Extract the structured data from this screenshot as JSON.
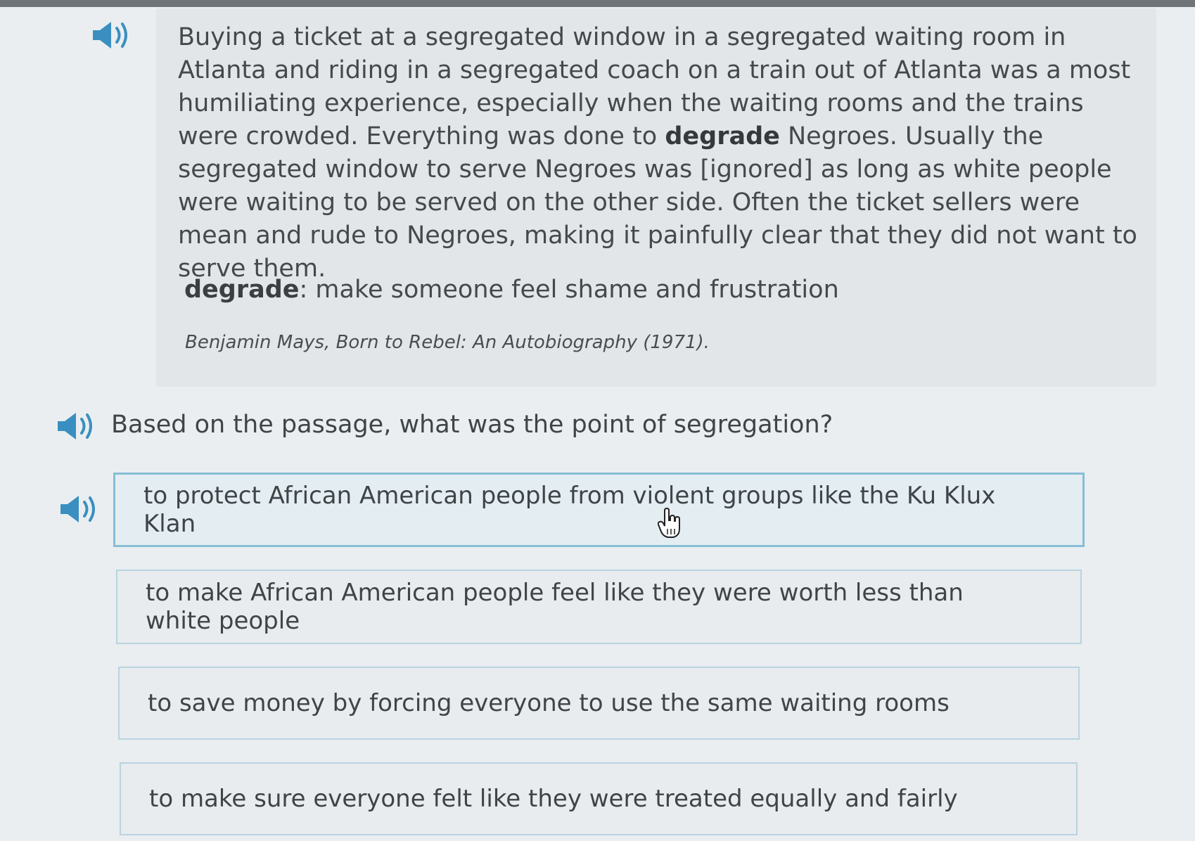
{
  "passage": {
    "segments": [
      {
        "text": "Buying a ticket at a segregated window in a segregated waiting room in Atlanta and riding in a segregated coach on a train out of Atlanta was a most humiliating experience, especially when the waiting rooms and the trains were crowded. Everything was done to ",
        "bold": false
      },
      {
        "text": "degrade",
        "bold": true
      },
      {
        "text": " Negroes. Usually the segregated window to serve Negroes was [ignored] as long as white people were waiting to be served on the other side. Often the ticket sellers were mean and rude to Negroes, making it painfully clear that they did not want to serve them.",
        "bold": false
      }
    ],
    "definition_term": "degrade",
    "definition_text": ": make someone feel shame and frustration",
    "citation": "Benjamin Mays, Born to Rebel: An Autobiography (1971)."
  },
  "question": {
    "text": "Based on the passage, what was the point of segregation?"
  },
  "choices": [
    {
      "label": "to protect African American people from violent groups like the Ku Klux Klan",
      "selected": true
    },
    {
      "label": "to make African American people feel like they were worth less than white people",
      "selected": false
    },
    {
      "label": "to save money by forcing everyone to use the same waiting rooms",
      "selected": false
    },
    {
      "label": "to make sure everyone felt like they were treated equally and fairly",
      "selected": false
    }
  ],
  "icons": {
    "audio": "speaker-icon",
    "cursor": "hand-pointer-icon"
  },
  "colors": {
    "speaker_blue": "#3a8fc0",
    "selected_border": "#86bed6",
    "choice_border": "#b9d3df"
  }
}
